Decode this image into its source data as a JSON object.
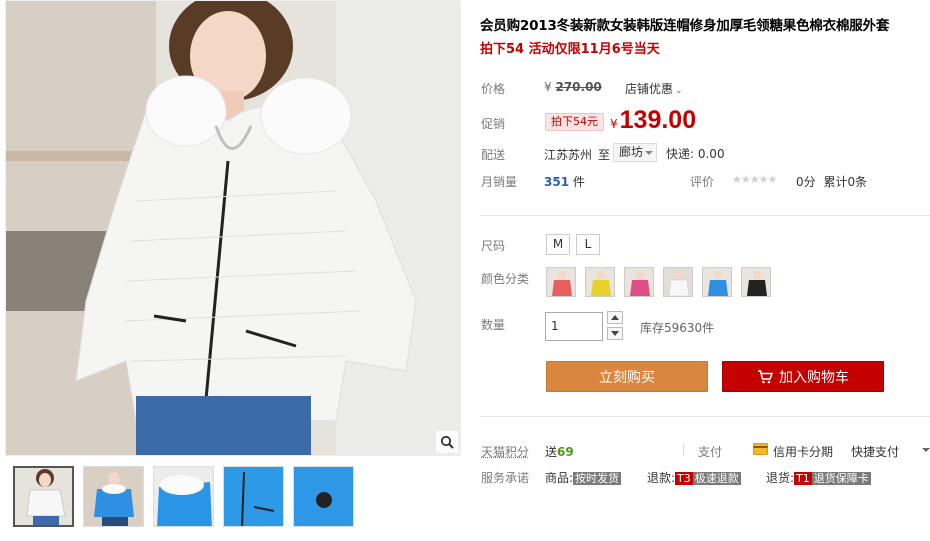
{
  "title": "会员购2013冬装新款女装韩版连帽修身加厚毛领糖果色棉衣棉服外套",
  "subtitle": "拍下54 活动仅限11月6号当天",
  "price": {
    "label": "价格",
    "currency": "¥",
    "original": "270.00",
    "shop_promo": "店铺优惠"
  },
  "promo": {
    "label": "促销",
    "badge": "拍下54元",
    "currency": "¥",
    "value": "139.00"
  },
  "delivery": {
    "label": "配送",
    "from": "江苏苏州",
    "to_word": "至",
    "city": "廊坊",
    "fee": "快递: 0.00"
  },
  "sales": {
    "label": "月销量",
    "count": "351",
    "unit": "件",
    "rating_label": "评价",
    "stars": "★★★★★",
    "score": "0分",
    "total": "累计0条"
  },
  "size": {
    "label": "尺码",
    "options": [
      "M",
      "L"
    ]
  },
  "colors": {
    "label": "颜色分类",
    "swatches": [
      "#e45f5f",
      "#e8d22a",
      "#e04e86",
      "#f4f4f4",
      "#2f8fe3",
      "#222222"
    ]
  },
  "quantity": {
    "label": "数量",
    "value": "1",
    "stock": "库存59630件"
  },
  "actions": {
    "buy_now": "立刻购买",
    "add_cart": "加入购物车"
  },
  "tmall": {
    "label": "天猫积分",
    "points_prefix": "送",
    "points": "69",
    "pay_label": "支付",
    "credit": "信用卡分期",
    "quick_pay": "快捷支付"
  },
  "service": {
    "label": "服务承诺",
    "goods_prefix": "商品:",
    "goods_tag": "按时发货",
    "refund_prefix": "退款:",
    "refund_t": "T3",
    "refund_tag": "极速退款",
    "return_prefix": "退货:",
    "return_t": "T1",
    "return_tag": "退货保障卡"
  },
  "colors_theme": {
    "accent_red": "#c40000",
    "buy_orange": "#d9873f",
    "link_blue": "#2b63a8"
  }
}
